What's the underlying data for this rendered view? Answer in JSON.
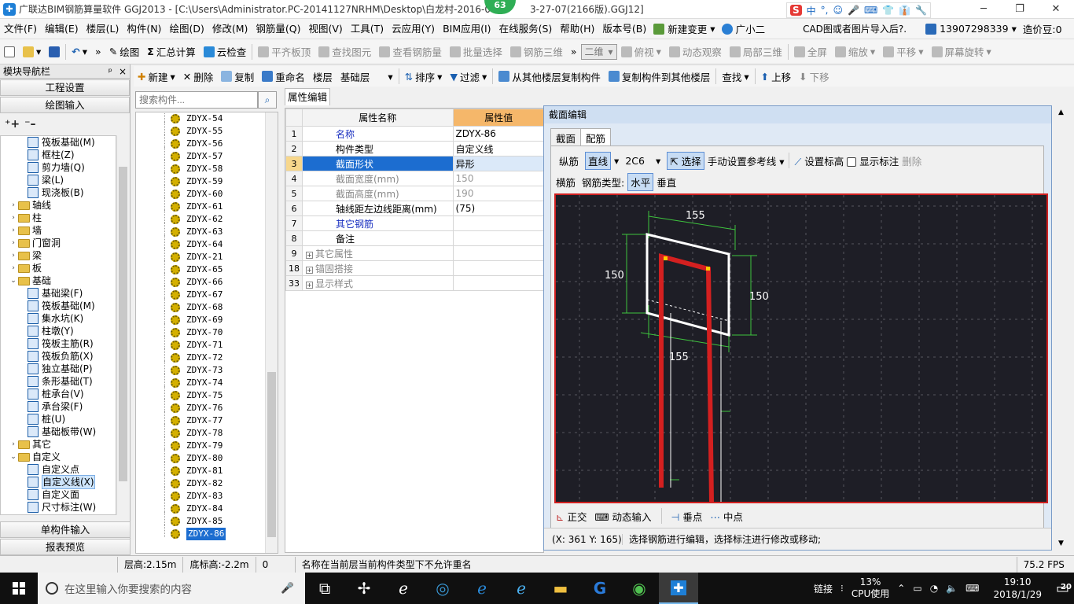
{
  "window": {
    "title": "广联达BIM钢筋算量软件 GGJ2013 - [C:\\Users\\Administrator.PC-20141127NRHM\\Desktop\\白龙村-2016-0",
    "title_tail": "3-27-07(2166版).GGJ12]",
    "badge": "63",
    "minimize": "─",
    "restore": "❐",
    "close": "✕"
  },
  "ime": {
    "logo": "S",
    "lang": "中",
    "items": [
      "°,",
      "☺",
      "🎤",
      "⌨",
      "👕",
      "👔",
      "🔧"
    ]
  },
  "menu": {
    "items": [
      "文件(F)",
      "编辑(E)",
      "楼层(L)",
      "构件(N)",
      "绘图(D)",
      "修改(M)",
      "钢筋量(Q)",
      "视图(V)",
      "工具(T)",
      "云应用(Y)",
      "BIM应用(I)",
      "在线服务(S)",
      "帮助(H)",
      "版本号(B)"
    ],
    "new_change": "新建变更",
    "assistant": "广小二",
    "cad_notice": "CAD图或者图片导入后?.",
    "phone": "13907298339",
    "beans": "造价豆:0"
  },
  "toolbar1": {
    "draw": "绘图",
    "sum": "汇总计算",
    "cloud_check": "云检查",
    "align_slab": "平齐板顶",
    "find_elem": "查找图元",
    "view_rebar": "查看钢筋量",
    "batch_select": "批量选择",
    "rebar_3d": "钢筋三维",
    "view_mode": "二维",
    "top_view": "俯视",
    "dynamic_view": "动态观察",
    "local_3d": "局部三维",
    "full_screen": "全屏",
    "zoom": "缩放",
    "pan": "平移",
    "rotate": "屏幕旋转"
  },
  "nav": {
    "title": "模块导航栏",
    "pin": "ᵖ",
    "close": "×",
    "project_settings": "工程设置",
    "drawing_input": "绘图输入",
    "single_input": "单构件输入",
    "report_preview": "报表预览",
    "tree": [
      {
        "level": 2,
        "label": "筏板基础(M)",
        "type": "item"
      },
      {
        "level": 2,
        "label": "框柱(Z)",
        "type": "item"
      },
      {
        "level": 2,
        "label": "剪力墙(Q)",
        "type": "item"
      },
      {
        "level": 2,
        "label": "梁(L)",
        "type": "item"
      },
      {
        "level": 2,
        "label": "现浇板(B)",
        "type": "item"
      },
      {
        "level": 1,
        "label": "轴线",
        "type": "folder",
        "exp": "›"
      },
      {
        "level": 1,
        "label": "柱",
        "type": "folder",
        "exp": "›"
      },
      {
        "level": 1,
        "label": "墙",
        "type": "folder",
        "exp": "›"
      },
      {
        "level": 1,
        "label": "门窗洞",
        "type": "folder",
        "exp": "›"
      },
      {
        "level": 1,
        "label": "梁",
        "type": "folder",
        "exp": "›"
      },
      {
        "level": 1,
        "label": "板",
        "type": "folder",
        "exp": "›"
      },
      {
        "level": 1,
        "label": "基础",
        "type": "folder",
        "exp": "⌄"
      },
      {
        "level": 2,
        "label": "基础梁(F)",
        "type": "item"
      },
      {
        "level": 2,
        "label": "筏板基础(M)",
        "type": "item"
      },
      {
        "level": 2,
        "label": "集水坑(K)",
        "type": "item"
      },
      {
        "level": 2,
        "label": "柱墩(Y)",
        "type": "item"
      },
      {
        "level": 2,
        "label": "筏板主筋(R)",
        "type": "item"
      },
      {
        "level": 2,
        "label": "筏板负筋(X)",
        "type": "item"
      },
      {
        "level": 2,
        "label": "独立基础(P)",
        "type": "item"
      },
      {
        "level": 2,
        "label": "条形基础(T)",
        "type": "item"
      },
      {
        "level": 2,
        "label": "桩承台(V)",
        "type": "item"
      },
      {
        "level": 2,
        "label": "承台梁(F)",
        "type": "item"
      },
      {
        "level": 2,
        "label": "桩(U)",
        "type": "item"
      },
      {
        "level": 2,
        "label": "基础板带(W)",
        "type": "item"
      },
      {
        "level": 1,
        "label": "其它",
        "type": "folder",
        "exp": "›"
      },
      {
        "level": 1,
        "label": "自定义",
        "type": "folder",
        "exp": "⌄"
      },
      {
        "level": 2,
        "label": "自定义点",
        "type": "item"
      },
      {
        "level": 2,
        "label": "自定义线(X)",
        "type": "item",
        "selected": true
      },
      {
        "level": 2,
        "label": "自定义面",
        "type": "item"
      },
      {
        "level": 2,
        "label": "尺寸标注(W)",
        "type": "item"
      }
    ]
  },
  "listtools": {
    "new": "新建",
    "delete": "删除",
    "copy": "复制",
    "rename": "重命名",
    "floor_label": "楼层",
    "floor_value": "基础层",
    "sort": "排序",
    "filter": "过滤",
    "copy_from": "从其他楼层复制构件",
    "copy_to": "复制构件到其他楼层",
    "find": "查找",
    "move_up": "上移",
    "move_down": "下移"
  },
  "search": {
    "placeholder": "搜索构件..."
  },
  "components": [
    "ZDYX-54",
    "ZDYX-55",
    "ZDYX-56",
    "ZDYX-57",
    "ZDYX-58",
    "ZDYX-59",
    "ZDYX-60",
    "ZDYX-61",
    "ZDYX-62",
    "ZDYX-63",
    "ZDYX-64",
    "ZDYX-21",
    "ZDYX-65",
    "ZDYX-66",
    "ZDYX-67",
    "ZDYX-68",
    "ZDYX-69",
    "ZDYX-70",
    "ZDYX-71",
    "ZDYX-72",
    "ZDYX-73",
    "ZDYX-74",
    "ZDYX-75",
    "ZDYX-76",
    "ZDYX-77",
    "ZDYX-78",
    "ZDYX-79",
    "ZDYX-80",
    "ZDYX-81",
    "ZDYX-82",
    "ZDYX-83",
    "ZDYX-84",
    "ZDYX-85",
    "ZDYX-86"
  ],
  "selected_component": "ZDYX-86",
  "props": {
    "tab": "属性编辑",
    "col_name": "属性名称",
    "col_value": "属性值",
    "rows": [
      {
        "num": "1",
        "name": "名称",
        "value": "ZDYX-86",
        "style": "blue"
      },
      {
        "num": "2",
        "name": "构件类型",
        "value": "自定义线",
        "style": ""
      },
      {
        "num": "3",
        "name": "截面形状",
        "value": "异形",
        "style": "blue",
        "selected": true
      },
      {
        "num": "4",
        "name": "截面宽度(mm)",
        "value": "150",
        "style": "gray"
      },
      {
        "num": "5",
        "name": "截面高度(mm)",
        "value": "190",
        "style": "gray"
      },
      {
        "num": "6",
        "name": "轴线距左边线距离(mm)",
        "value": "(75)",
        "style": ""
      },
      {
        "num": "7",
        "name": "其它钢筋",
        "value": "",
        "style": "blue"
      },
      {
        "num": "8",
        "name": "备注",
        "value": "",
        "style": ""
      },
      {
        "num": "9",
        "name": "其它属性",
        "value": "",
        "style": "gray",
        "plus": true
      },
      {
        "num": "18",
        "name": "锚固搭接",
        "value": "",
        "style": "gray",
        "plus": true
      },
      {
        "num": "33",
        "name": "显示样式",
        "value": "",
        "style": "gray",
        "plus": true
      }
    ]
  },
  "section": {
    "title": "截面编辑",
    "tab_section": "截面",
    "tab_rebar": "配筋",
    "longitudinal": "纵筋",
    "line": "直线",
    "rebar_spec": "2C6",
    "select": "选择",
    "manual_ref": "手动设置参考线",
    "set_elev": "设置标高",
    "show_label": "显示标注",
    "delete": "删除",
    "transverse": "横筋",
    "rebar_type_label": "钢筋类型:",
    "horizontal": "水平",
    "vertical": "垂直",
    "dims": {
      "top": "155",
      "left": "150",
      "right": "150",
      "bottom": "155"
    },
    "ortho": "正交",
    "dyn_input": "动态输入",
    "perp": "垂点",
    "midpoint": "中点",
    "coord": "(X: 361 Y: 165)",
    "hint": "选择钢筋进行编辑，选择标注进行修改或移动;"
  },
  "status": {
    "floor_height": "层高:2.15m",
    "bottom_elev": "底标高:-2.2m",
    "zero": "0",
    "message": "名称在当前层当前构件类型下不允许重名",
    "fps": "75.2 FPS"
  },
  "taskbar": {
    "search_placeholder": "在这里输入你要搜索的内容",
    "link": "链接",
    "cpu": "13%",
    "cpu_label": "CPU使用",
    "time": "19:10",
    "date": "2018/1/29",
    "notif": "20"
  },
  "colors": {
    "selected": "#1c6dd0",
    "rebar": "#d42020",
    "canvas": "#1e1e26",
    "dim": "#3ec43e"
  }
}
